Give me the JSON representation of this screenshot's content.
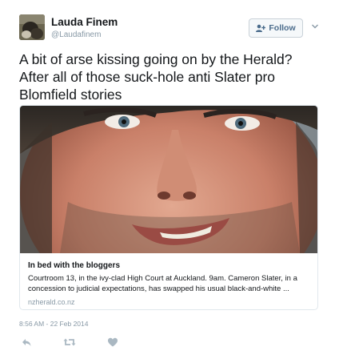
{
  "author": {
    "display_name": "Lauda Finem",
    "handle": "@Laudafinem"
  },
  "follow_button": {
    "label": "Follow"
  },
  "tweet": {
    "text": "A bit of arse kissing going on by the Herald? After all of those suck-hole anti Slater pro Blomfield stories",
    "timestamp": "8:56 AM - 22 Feb 2014"
  },
  "card": {
    "title": "In bed with the bloggers",
    "description": "Courtroom 13, in the ivy-clad High Court at Auckland. 9am. Cameron Slater, in a concession to judicial expectations, has swapped his usual black-and-white ...",
    "domain": "nzherald.co.nz"
  },
  "icons": {
    "follow": "add-user-icon",
    "menu": "chevron-down-icon",
    "reply": "reply-icon",
    "retweet": "retweet-icon",
    "like": "heart-icon"
  },
  "colors": {
    "text": "#14171a",
    "muted": "#8899a6",
    "follow_text": "#4b6c8c",
    "border": "#e1e8ed"
  }
}
